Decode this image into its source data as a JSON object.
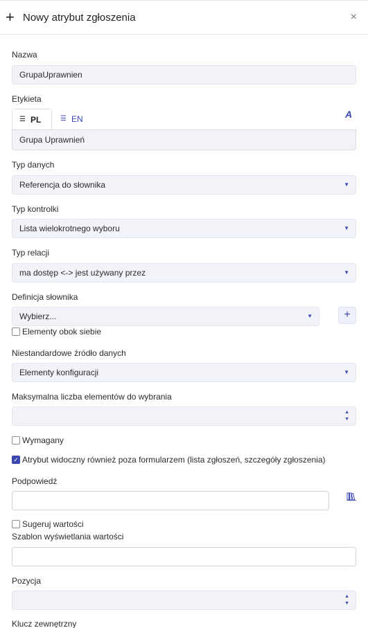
{
  "header": {
    "title": "Nowy atrybut zgłoszenia",
    "plus_icon": "+",
    "close_icon": "×"
  },
  "name": {
    "label": "Nazwa",
    "value": "GrupaUprawnien"
  },
  "label_field": {
    "label": "Etykieta",
    "tabs": [
      {
        "label": "PL",
        "active": true
      },
      {
        "label": "EN",
        "active": false
      }
    ],
    "value": "Grupa Uprawnień"
  },
  "data_type": {
    "label": "Typ danych",
    "value": "Referencja do słownika"
  },
  "control_type": {
    "label": "Typ kontrolki",
    "value": "Lista wielokrotnego wyboru"
  },
  "relation_type": {
    "label": "Typ relacji",
    "value": "ma dostęp <-> jest używany przez"
  },
  "dictionary": {
    "label": "Definicja słownika",
    "value": "Wybierz...",
    "add_label": "+"
  },
  "side_by_side": {
    "label": "Elementy obok siebie",
    "checked": false
  },
  "custom_source": {
    "label": "Niestandardowe źródło danych",
    "value": "Elementy konfiguracji"
  },
  "max_items": {
    "label": "Maksymalna liczba elementów do wybrania",
    "value": ""
  },
  "required": {
    "label": "Wymagany",
    "checked": false
  },
  "visible_outside": {
    "label": "Atrybut widoczny również poza formularzem (lista zgłoszeń, szczegóły zgłoszenia)",
    "checked": true
  },
  "hint": {
    "label": "Podpowiedź",
    "value": ""
  },
  "suggest": {
    "label": "Sugeruj wartości",
    "checked": false
  },
  "display_template": {
    "label": "Szablon wyświetlania wartości",
    "value": ""
  },
  "position": {
    "label": "Pozycja",
    "value": ""
  },
  "external_key": {
    "label": "Klucz zewnętrzny"
  },
  "colors": {
    "accent": "#3b46b0",
    "field_bg": "#f2f3f8"
  },
  "icons": {
    "tab_icon": "lines-icon",
    "translate": "A",
    "library": "books-icon",
    "dropdown": "▼",
    "spin_up": "▲",
    "spin_down": "▼",
    "check": "✓"
  }
}
